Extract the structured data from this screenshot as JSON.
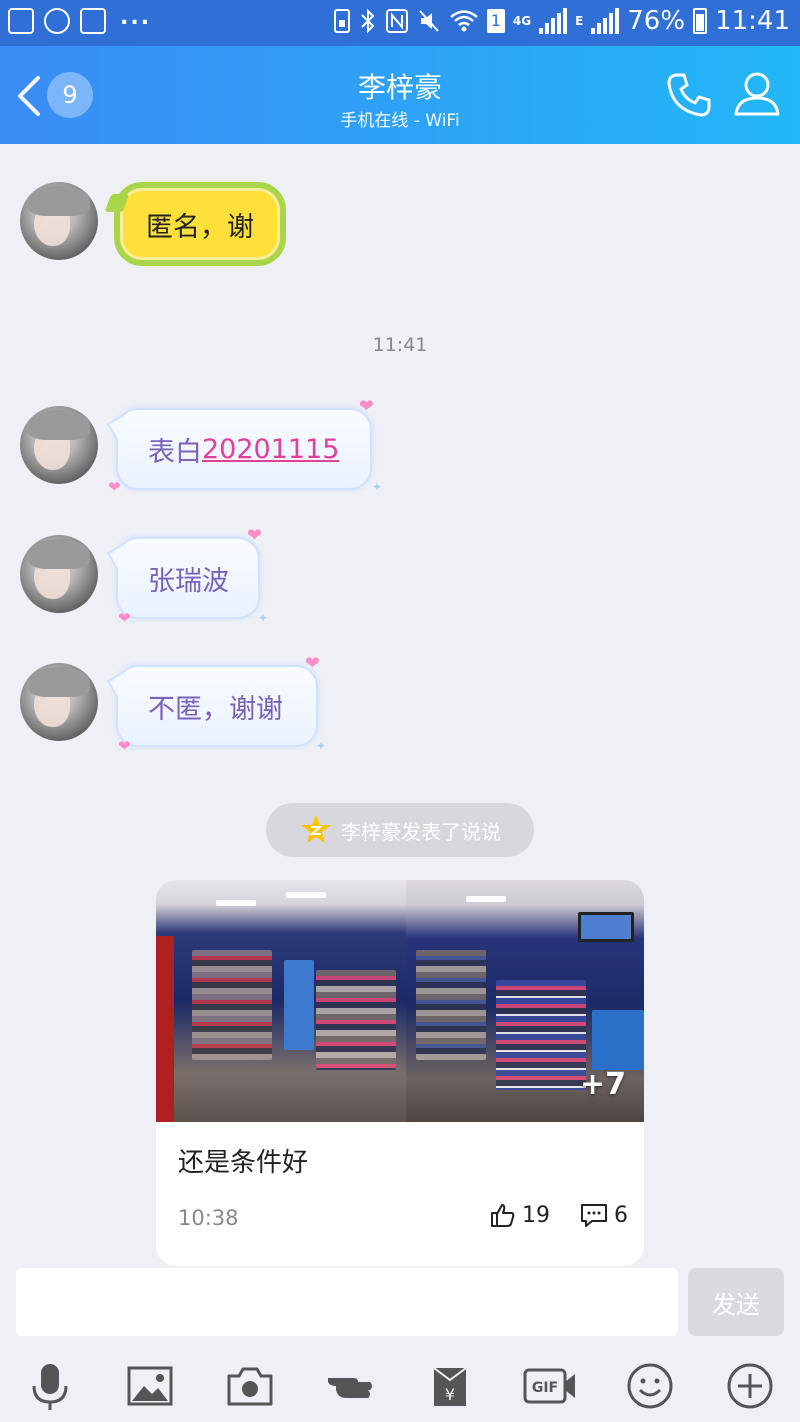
{
  "status_bar": {
    "battery": "76%",
    "time": "11:41",
    "network_4g": "4G",
    "network_e": "E",
    "sim_slot": "1",
    "overflow": "..."
  },
  "header": {
    "unread_count": "9",
    "contact_name": "李梓豪",
    "status": "手机在线 - WiFi"
  },
  "messages": [
    {
      "text": "匿名，谢",
      "style": "lemon"
    },
    {
      "text_plain": "表白",
      "text_link": "20201115",
      "style": "pink"
    },
    {
      "text": "张瑞波",
      "style": "pink"
    },
    {
      "text": "不匿，谢谢",
      "style": "pink"
    }
  ],
  "timestamp": "11:41",
  "notice": "李梓豪发表了说说",
  "post": {
    "more_photos": "+7",
    "caption": "还是条件好",
    "time": "10:38",
    "likes": "19",
    "comments": "6"
  },
  "input": {
    "send_label": "发送",
    "placeholder": ""
  },
  "toolbar": {
    "gif_label": "GIF",
    "yen_label": "¥"
  },
  "colors": {
    "header_start": "#3a8cf5",
    "header_end": "#22b7f6",
    "link": "#e0409a",
    "bubble_text": "#7a62b8"
  }
}
